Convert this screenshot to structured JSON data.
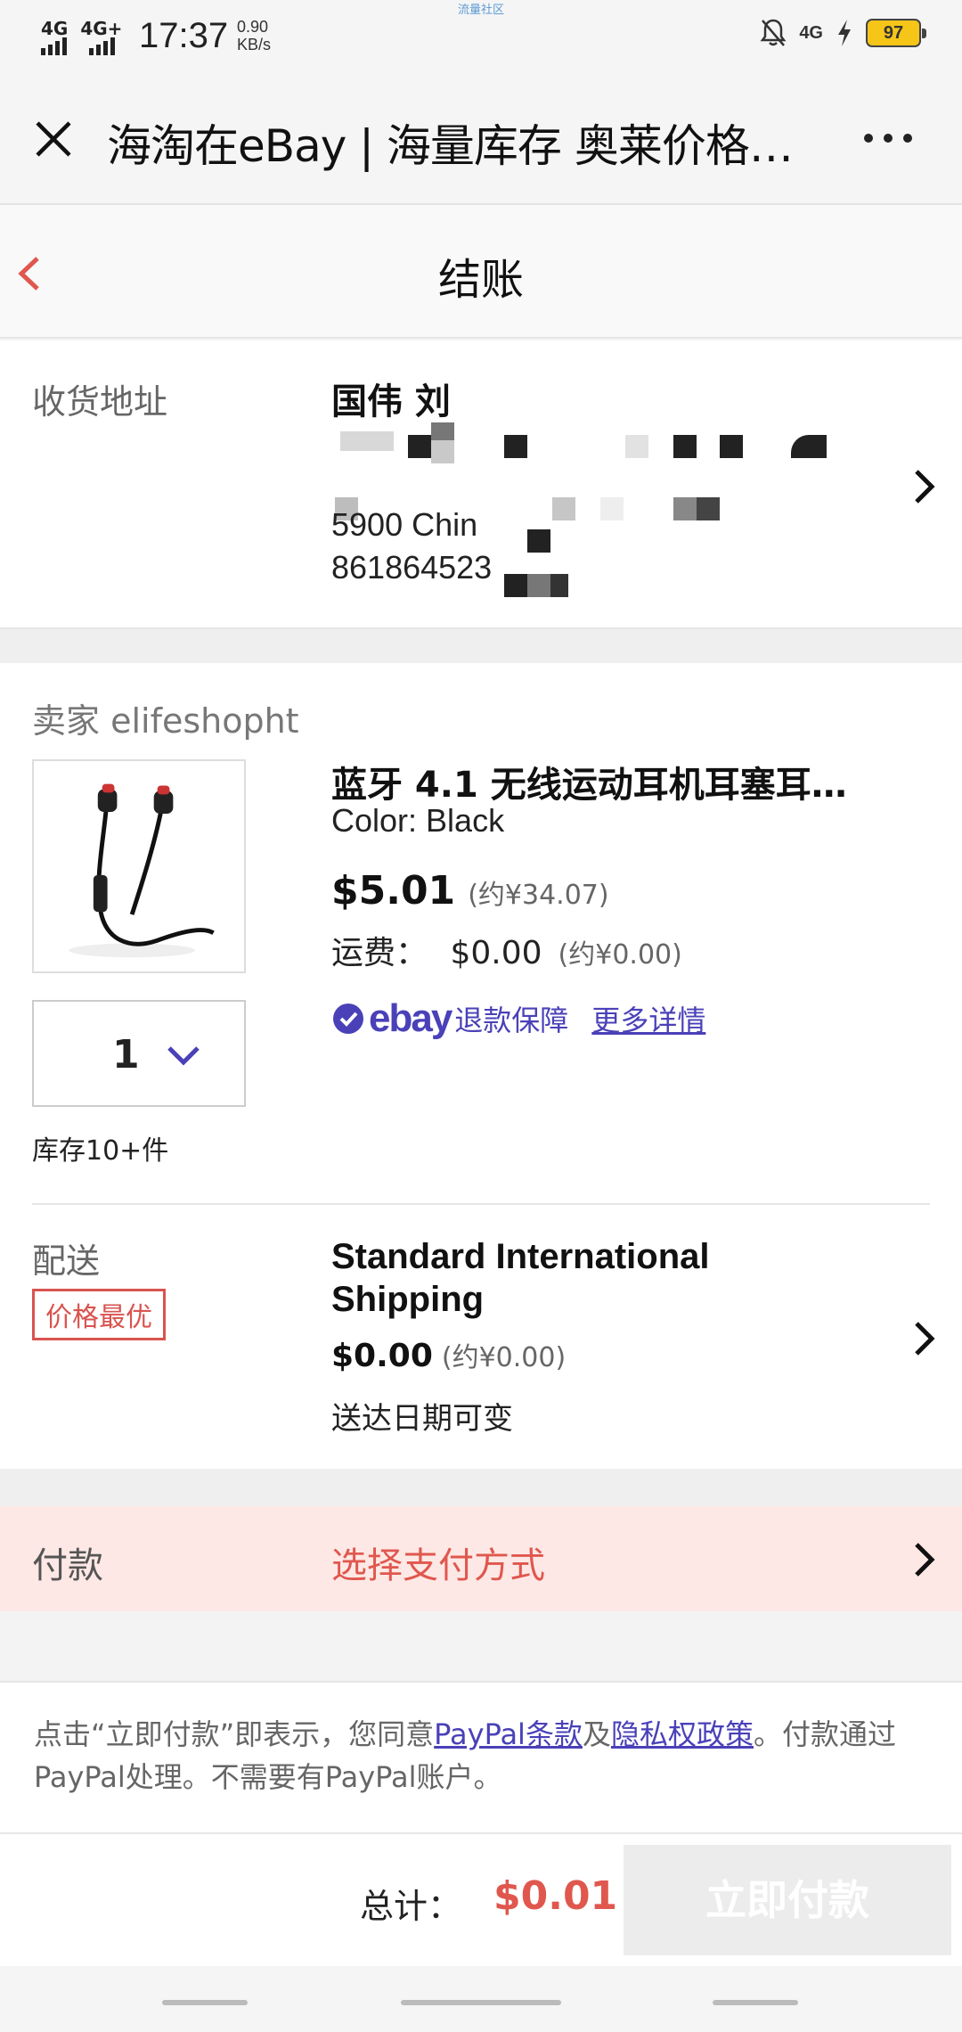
{
  "status_bar": {
    "net1": "4G",
    "net2": "4G+",
    "time": "17:37",
    "speed_value": "0.90",
    "speed_unit": "KB/s",
    "center_text": "流量社区",
    "net3": "4G",
    "battery": "97"
  },
  "nav": {
    "title": "海淘在eBay | 海量库存 奥莱价格…"
  },
  "page": {
    "title": "结账"
  },
  "address": {
    "label": "收货地址",
    "name": "国伟 刘",
    "line3": "5900 Chin",
    "phone": "861864523"
  },
  "item": {
    "seller_label": "卖家 elifeshopht",
    "title": "蓝牙 4.1 无线运动耳机耳塞耳...",
    "color": "Color: Black",
    "price": "$5.01",
    "price_cny": "(约¥34.07)",
    "shipping_fee_label": "运费：",
    "shipping_fee": "$0.00",
    "shipping_fee_cny": "(约¥0.00)",
    "ebay_logo": "ebay",
    "guarantee_text": "退款保障",
    "more_link": "更多详情",
    "quantity": "1",
    "stock": "库存10+件"
  },
  "shipping": {
    "label": "配送",
    "badge": "价格最优",
    "method": "Standard International Shipping",
    "cost": "$0.00",
    "cost_cny": "(约¥0.00)",
    "delivery": "送达日期可变"
  },
  "payment": {
    "label": "付款",
    "choose": "选择支付方式"
  },
  "terms": {
    "part1": "点击“立即付款”即表示，您同意",
    "link1": "PayPal条款",
    "part2": "及",
    "link2": "隐私权政策",
    "part3": "。付款通过PayPal处理。不需要有PayPal账户。"
  },
  "footer": {
    "total_label": "总计：",
    "total_value": "$0.01",
    "pay_button": "立即付款"
  },
  "colors": {
    "accent_red": "#e0574e",
    "ebay_purple": "#4a41b8",
    "payment_bg": "#fde8e5",
    "battery": "#f5c518"
  }
}
